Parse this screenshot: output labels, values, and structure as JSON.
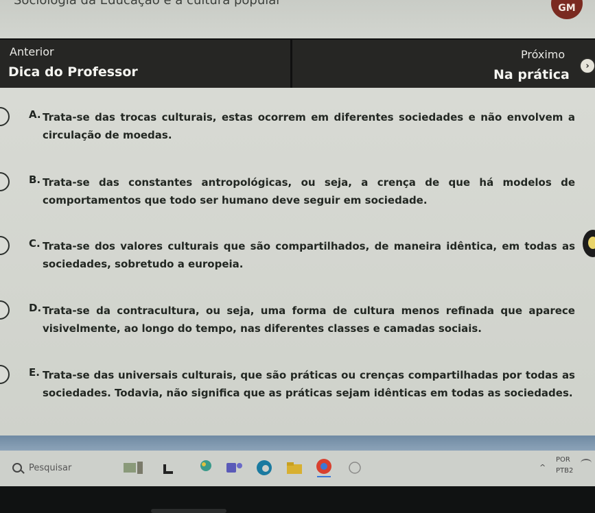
{
  "header": {
    "course_title": "Sociologia da Educação e a cultura popular",
    "avatar_initials": "GM"
  },
  "nav": {
    "prev_small": "Anterior",
    "prev_big": "Dica do Professor",
    "next_small": "Próximo",
    "next_big": "Na prática",
    "next_icon": "chevron-right-circle-icon"
  },
  "options": [
    {
      "letter": "A.",
      "text": "Trata-se das trocas culturais, estas ocorrem em diferentes sociedades e não envolvem a circulação de moedas."
    },
    {
      "letter": "B.",
      "text": "Trata-se das constantes antropológicas, ou seja, a crença de que há modelos de comportamentos que todo ser humano deve seguir em sociedade."
    },
    {
      "letter": "C.",
      "text": "Trata-se dos valores culturais que são compartilhados, de maneira idêntica, em todas as sociedades, sobretudo a europeia."
    },
    {
      "letter": "D.",
      "text": "Trata-se da contracultura, ou seja, uma forma de cultura menos refinada que aparece visivelmente, ao longo do tempo, nas diferentes classes e camadas sociais."
    },
    {
      "letter": "E.",
      "text": "Trata-se das universais culturais, que são práticas ou crenças compartilhadas por todas as sociedades. Todavia, não significa que as práticas sejam idênticas em todas as sociedades."
    }
  ],
  "taskbar": {
    "search_placeholder": "Pesquisar",
    "lang_top": "POR",
    "lang_bottom": "PTB2"
  },
  "colors": {
    "navbar": "#262624",
    "content_bg": "#d8dad4",
    "avatar": "#7a2a20",
    "accent_blue": "#6f8aa3"
  }
}
